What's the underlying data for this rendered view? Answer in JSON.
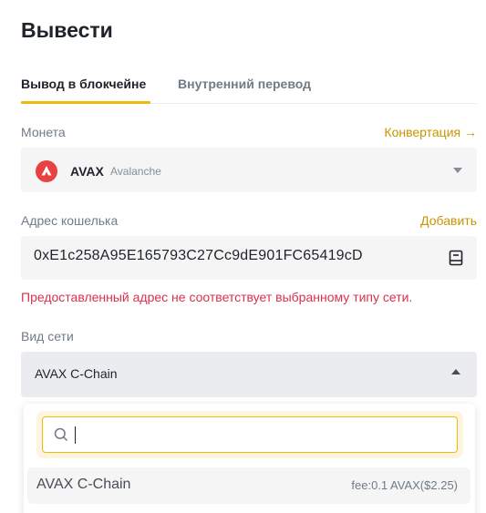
{
  "page": {
    "title": "Вывести"
  },
  "tabs": [
    {
      "label": "Вывод в блокчейне"
    },
    {
      "label": "Внутренний перевод"
    }
  ],
  "coin": {
    "label": "Монета",
    "convert_link": "Конвертация →",
    "symbol": "AVAX",
    "name": "Avalanche",
    "icon": "avalanche-logo"
  },
  "wallet": {
    "label": "Адрес кошелька",
    "add_link": "Добавить",
    "address": "0xE1c258A95E165793C27Cc9dE901FC65419cD",
    "icon": "address-book-icon"
  },
  "error_message": "Предоставленный адрес не соответствует выбранному типу сети.",
  "network": {
    "label": "Вид сети",
    "selected": "AVAX C-Chain",
    "search_placeholder": "",
    "options": [
      {
        "name": "AVAX C-Chain",
        "fee": "fee:0.1  AVAX($2.25)"
      }
    ]
  },
  "colors": {
    "accent": "#f0b90b",
    "link": "#c99400",
    "error": "#d9304e",
    "avax": "#e84142"
  }
}
